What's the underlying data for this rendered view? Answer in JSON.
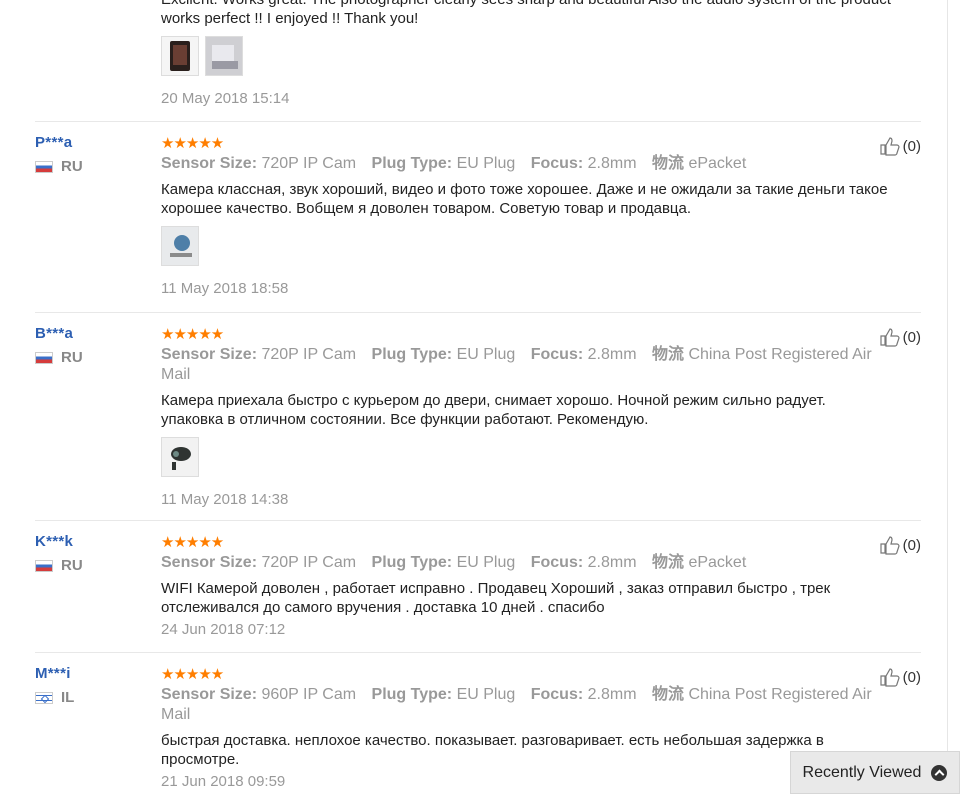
{
  "reviews": [
    {
      "text": "Excilent. Works great. The photographer clearly sees sharp and beautiful Also the audio system of the product works perfect !! I enjoyed !! Thank you!",
      "date": "20 May 2018 15:14",
      "images": [
        "photo-phone",
        "photo-room"
      ]
    },
    {
      "user": "P***a",
      "country": "RU",
      "stars": "★★★★★",
      "sensor_label": "Sensor Size:",
      "sensor": "720P IP Cam",
      "plug_label": "Plug Type:",
      "plug": "EU Plug",
      "focus_label": "Focus:",
      "focus": "2.8mm",
      "ship_label": "物流",
      "ship": "ePacket",
      "text": "Камера классная, звук хороший, видео и фото тоже хорошее. Даже и не ожидали за такие деньги такое хорошее качество. Вобщем я доволен товаром. Советую товар и продавца.",
      "date": "11 May 2018 18:58",
      "likes": "(0)"
    },
    {
      "user": "B***a",
      "country": "RU",
      "stars": "★★★★★",
      "sensor_label": "Sensor Size:",
      "sensor": "720P IP Cam",
      "plug_label": "Plug Type:",
      "plug": "EU Plug",
      "focus_label": "Focus:",
      "focus": "2.8mm",
      "ship_label": "物流",
      "ship": "China Post Registered Air Mail",
      "text": "Камера приехала быстро с курьером до двери, снимает хорошо. Ночной режим сильно радует. упаковка в отличном состоянии. Все функции работают. Рекомендую.",
      "date": "11 May 2018 14:38",
      "likes": "(0)"
    },
    {
      "user": "K***k",
      "country": "RU",
      "stars": "★★★★★",
      "sensor_label": "Sensor Size:",
      "sensor": "720P IP Cam",
      "plug_label": "Plug Type:",
      "plug": "EU Plug",
      "focus_label": "Focus:",
      "focus": "2.8mm",
      "ship_label": "物流",
      "ship": "ePacket",
      "text": "WIFI Камерой доволен , работает исправно . Продавец Хороший , заказ отправил быстро , трек отслеживался до самого вручения . доставка 10 дней . спасибо",
      "date": "24 Jun 2018 07:12",
      "likes": "(0)"
    },
    {
      "user": "M***i",
      "country": "IL",
      "stars": "★★★★★",
      "sensor_label": "Sensor Size:",
      "sensor": "960P IP Cam",
      "plug_label": "Plug Type:",
      "plug": "EU Plug",
      "focus_label": "Focus:",
      "focus": "2.8mm",
      "ship_label": "物流",
      "ship": "China Post Registered Air Mail",
      "text": "быстрая доставка. неплохое качество. показывает. разговаривает. есть небольшая задержка в просмотре.",
      "date": "21 Jun 2018 09:59",
      "likes": "(0)"
    }
  ],
  "recently_viewed": {
    "label": "Recently Viewed"
  },
  "colors": {
    "stars": "#ff7e00",
    "username": "#2d5fb2"
  }
}
